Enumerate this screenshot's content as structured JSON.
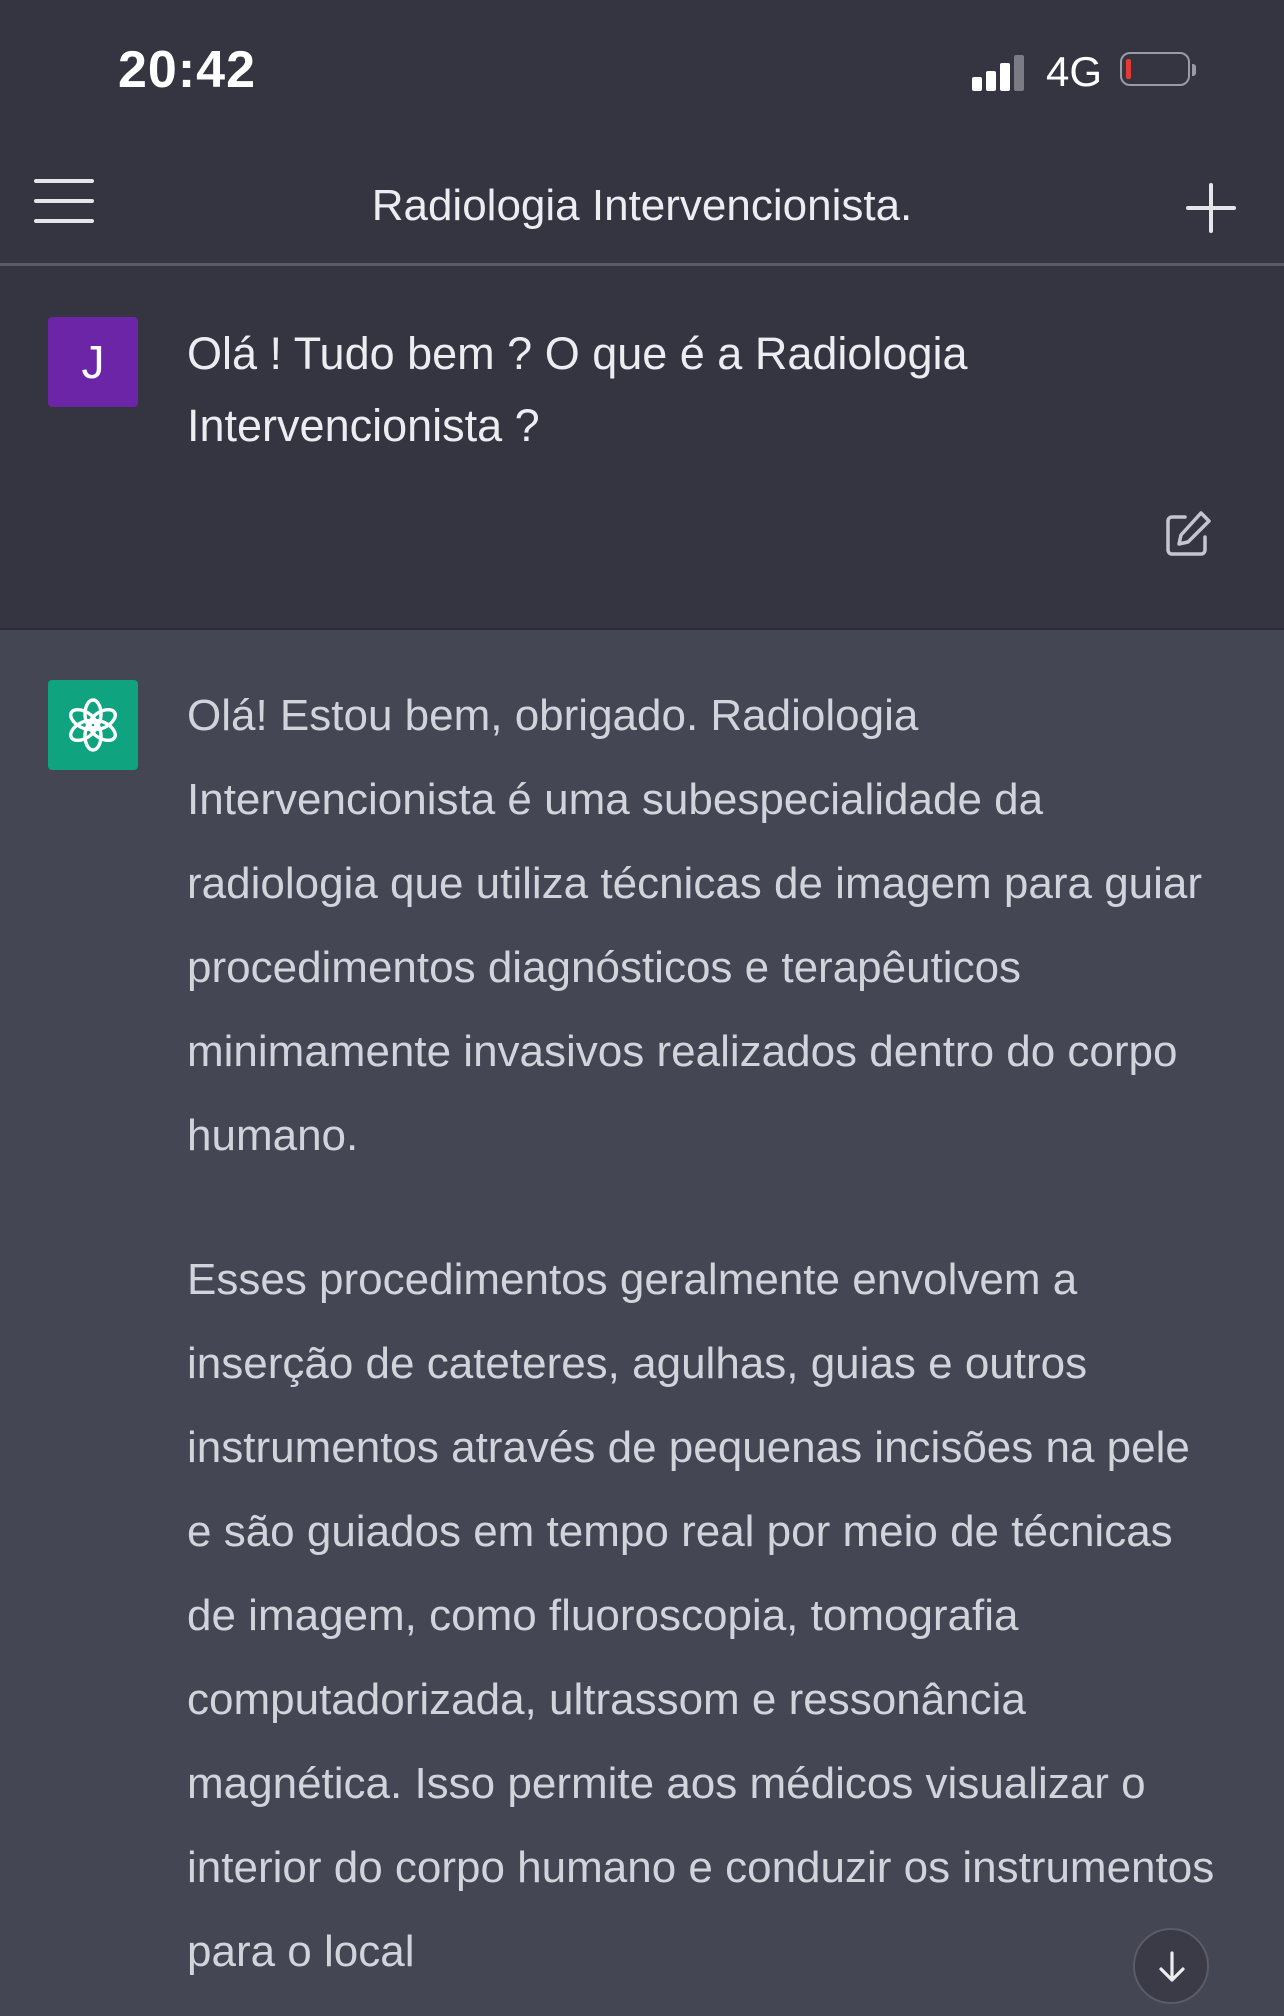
{
  "status_bar": {
    "time": "20:42",
    "network": "4G",
    "signal_icon": "cellular-signal-icon",
    "battery_icon": "battery-low-icon",
    "battery_level_fraction": 0.05,
    "battery_color": "#e53935"
  },
  "nav": {
    "title": "Radiologia Intervencionista.",
    "menu_icon": "hamburger-menu-icon",
    "new_chat_icon": "plus-icon"
  },
  "user_message": {
    "avatar_letter": "J",
    "avatar_color": "#6b25a6",
    "text": "Olá ! Tudo bem ? O que é a Radiologia Intervencionista ?",
    "edit_icon": "edit-icon"
  },
  "assistant_message": {
    "avatar_icon": "openai-logo-icon",
    "avatar_color": "#10a37f",
    "paragraphs": [
      "Olá! Estou bem, obrigado. Radiologia Intervencionista é uma subespecialidade da radiologia que utiliza técnicas de imagem para guiar procedimentos diagnósticos e terapêuticos minimamente invasivos realizados dentro do corpo humano.",
      "Esses procedimentos geralmente envolvem a inserção de cateteres, agulhas, guias e outros instrumentos através de pequenas incisões na pele e são guiados em tempo real por meio de técnicas de imagem, como fluoroscopia, tomografia computadorizada, ultrassom e ressonância magnética. Isso permite aos médicos visualizar o interior do corpo humano e conduzir os instrumentos para o local"
    ]
  },
  "scroll_button": {
    "icon": "arrow-down-icon"
  },
  "colors": {
    "header_bg": "#343541",
    "assistant_bg": "#444654"
  }
}
